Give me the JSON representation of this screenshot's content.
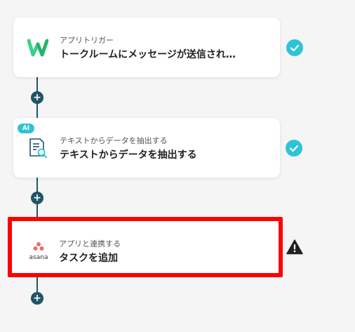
{
  "steps": [
    {
      "subtitle": "アプリトリガー",
      "title": "トークルームにメッセージが送信され…",
      "icon": "waitwhile-w-icon",
      "status": "complete"
    },
    {
      "badge": "AI",
      "subtitle": "テキストからデータを抽出する",
      "title": "テキストからデータを抽出する",
      "icon": "document-search-icon",
      "status": "complete"
    },
    {
      "subtitle": "アプリと連携する",
      "title": "タスクを追加",
      "icon": "asana-logo-icon",
      "logo_text": "asana",
      "status": "warning"
    }
  ],
  "add_label": "+",
  "colors": {
    "connector": "#1f5566",
    "check": "#2ec4d6",
    "highlight": "#ff0000",
    "warning": "#222222",
    "asana": "#f06a6a"
  }
}
